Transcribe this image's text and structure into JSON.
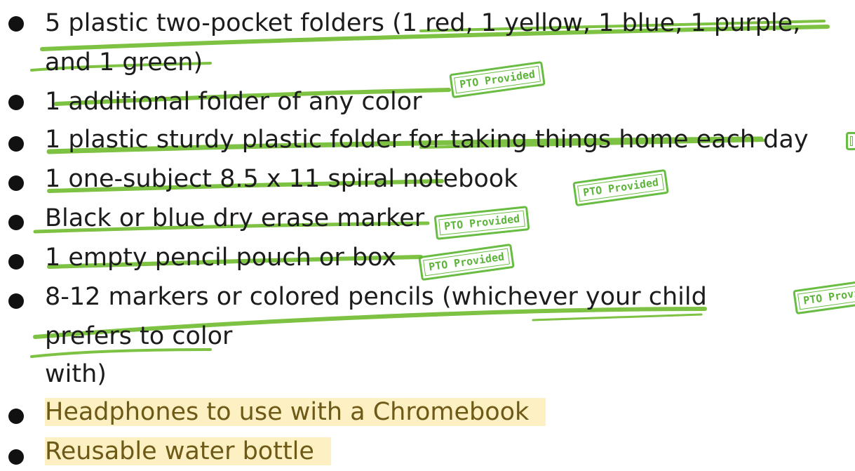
{
  "items": [
    {
      "lines": [
        "5 plastic two-pocket folders (1 red, 1 yellow, 1 blue, 1 purple,",
        "and 1 green)"
      ]
    },
    {
      "lines": [
        "1 additional folder of any color"
      ]
    },
    {
      "lines": [
        "1 plastic sturdy plastic folder for taking things home each day"
      ]
    },
    {
      "lines": [
        "1 one-subject 8.5 x 11 spiral notebook"
      ]
    },
    {
      "lines": [
        "Black or blue dry erase marker"
      ]
    },
    {
      "lines": [
        "1 empty pencil pouch or box"
      ]
    },
    {
      "lines": [
        "8-12 markers or colored pencils (whichever your child",
        "prefers to color",
        "with)"
      ]
    },
    {
      "lines": [
        "Headphones to use with a Chromebook"
      ],
      "highlighted": true
    },
    {
      "lines": [
        "Reusable water bottle"
      ],
      "highlighted": true
    }
  ],
  "stamps": {
    "label": "PTO Provided"
  },
  "colors": {
    "strike_green": "#7dc242",
    "stamp_green": "#5bb731",
    "highlight_bg": "#fdf0c3",
    "highlight_text": "#6e5a17"
  }
}
